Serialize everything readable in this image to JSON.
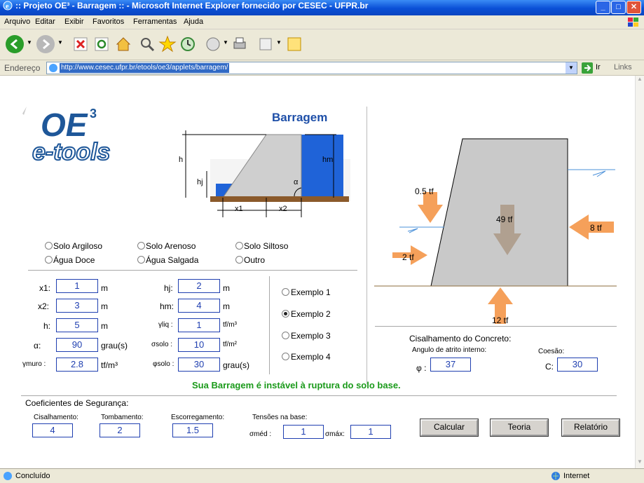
{
  "window": {
    "title": ":: Projeto OE³ - Barragem :: - Microsoft Internet Explorer fornecido por CESEC - UFPR.br"
  },
  "menu": {
    "items": [
      "Arquivo",
      "Editar",
      "Exibir",
      "Favoritos",
      "Ferramentas",
      "Ajuda"
    ]
  },
  "address": {
    "label": "Endereço",
    "url": "http://www.cesec.ufpr.br/etools/oe3/applets/barragem/",
    "go": "Ir",
    "links": "Links"
  },
  "logo": {
    "line1": "OE",
    "sup": "3",
    "line2": "e-tools"
  },
  "diagram": {
    "title": "Barragem",
    "h": "h",
    "hj": "hj",
    "hm": "hm",
    "alpha": "α",
    "x1": "x1",
    "x2": "x2"
  },
  "soil_options": [
    "Solo Argiloso",
    "Solo Arenoso",
    "Solo Siltoso",
    "Água Doce",
    "Água Salgada",
    "Outro"
  ],
  "inputs": {
    "x1": {
      "label": "x1:",
      "value": "1",
      "unit": "m"
    },
    "x2": {
      "label": "x2:",
      "value": "3",
      "unit": "m"
    },
    "h": {
      "label": "h:",
      "value": "5",
      "unit": "m"
    },
    "alpha": {
      "label": "α:",
      "value": "90",
      "unit": "grau(s)"
    },
    "gamma_muro": {
      "label": "γmuro :",
      "value": "2.8",
      "unit": "tf/m³"
    },
    "hj": {
      "label": "hj:",
      "value": "2",
      "unit": "m"
    },
    "hm": {
      "label": "hm:",
      "value": "4",
      "unit": "m"
    },
    "gamma_liq": {
      "label": "γliq :",
      "value": "1",
      "unit": "tf/m³"
    },
    "sigma_solo": {
      "label": "σsolo :",
      "value": "10",
      "unit": "tf/m²"
    },
    "phi_solo": {
      "label": "φsolo :",
      "value": "30",
      "unit": "grau(s)"
    }
  },
  "examples": [
    {
      "label": "Exemplo 1",
      "selected": false
    },
    {
      "label": "Exemplo 2",
      "selected": true
    },
    {
      "label": "Exemplo 3",
      "selected": false
    },
    {
      "label": "Exemplo 4",
      "selected": false
    }
  ],
  "forces": {
    "top_load": "0.5 tf",
    "weight": "49 tf",
    "right_water": "8 tf",
    "left_water": "2 tf",
    "uplift": "12 tf"
  },
  "concrete_shear": {
    "title": "Cisalhamento do Concreto:",
    "friction_label": "Angulo de atrito interno:",
    "phi_label": "φ :",
    "phi_value": "37",
    "cohesion_label": "Coesão:",
    "c_label": "C:",
    "c_value": "30"
  },
  "message": "Sua Barragem é instável à ruptura do solo base.",
  "safety": {
    "title": "Coeficientes de Segurança:",
    "shear_label": "Cisalhamento:",
    "shear_value": "4",
    "overturn_label": "Tombamento:",
    "overturn_value": "2",
    "slide_label": "Escorregamento:",
    "slide_value": "1.5",
    "stress_label": "Tensões na base:",
    "sigma_med_label": "σméd :",
    "sigma_med_value": "1",
    "sigma_max_label": "σmáx:",
    "sigma_max_value": "1"
  },
  "buttons": {
    "calc": "Calcular",
    "theory": "Teoria",
    "report": "Relatório"
  },
  "status": {
    "text": "Concluído",
    "zone": "Internet"
  },
  "colors": {
    "titlebar": "#0a4fd6",
    "input_border": "#1f3fb0",
    "message": "#1a9a1a",
    "arrow": "#f5a05a",
    "wall": "#c9c9c9",
    "water": "#4a90d9"
  }
}
